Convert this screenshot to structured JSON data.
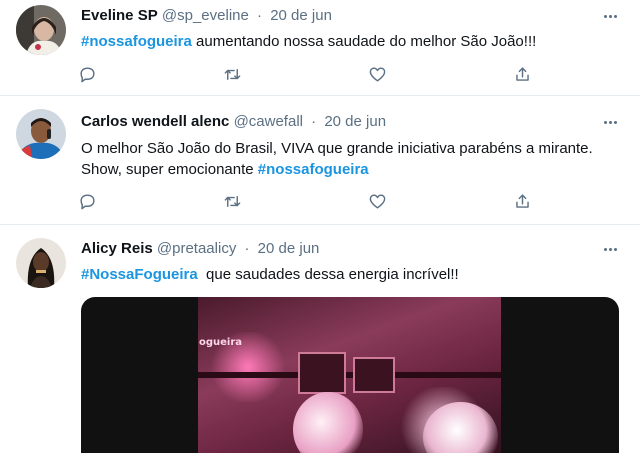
{
  "tweets": [
    {
      "name": "Eveline SP",
      "handle": "@sp_eveline",
      "separator": "·",
      "date": "20 de jun",
      "hashtag": "#nossafogueira",
      "text_after": " aumentando nossa saudade do melhor São João!!!"
    },
    {
      "name": "Carlos wendell alenc",
      "handle": "@cawefall",
      "separator": "·",
      "date": "20 de jun",
      "text_before": "O melhor São João do Brasil, VIVA que grande iniciativa parabéns a mirante. Show, super emocionante ",
      "hashtag": "#nossafogueira"
    },
    {
      "name": "Alicy Reis",
      "handle": "@pretaalicy",
      "separator": "·",
      "date": "20 de jun",
      "hashtag": "#NossaFogueira",
      "text_after": "  que saudades dessa energia incrível!!",
      "media_text": "ogueira"
    }
  ],
  "icons": [
    "reply-icon",
    "retweet-icon",
    "like-icon",
    "share-icon",
    "more-icon"
  ],
  "colors": {
    "hashtag": "#1b95e0",
    "secondary_text": "#5b7083",
    "divider": "#e6ecf0"
  }
}
